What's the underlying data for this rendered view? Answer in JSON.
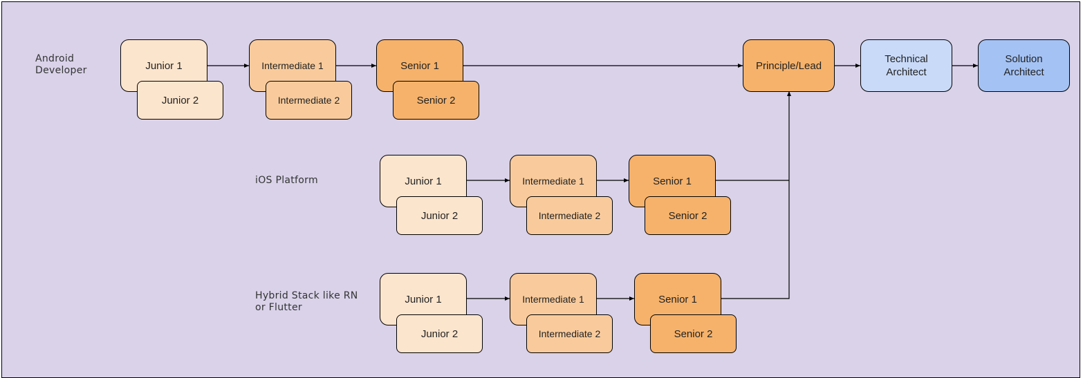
{
  "lanes": [
    {
      "label": "Android\nDeveloper",
      "junior1": "Junior 1",
      "junior2": "Junior 2",
      "inter1": "Intermediate 1",
      "inter2": "Intermediate 2",
      "senior1": "Senior 1",
      "senior2": "Senior 2"
    },
    {
      "label": "iOS Platform",
      "junior1": "Junior 1",
      "junior2": "Junior 2",
      "inter1": "Intermediate 1",
      "inter2": "Intermediate 2",
      "senior1": "Senior 1",
      "senior2": "Senior 2"
    },
    {
      "label": "Hybrid Stack like RN\nor Flutter",
      "junior1": "Junior 1",
      "junior2": "Junior 2",
      "inter1": "Intermediate 1",
      "inter2": "Intermediate 2",
      "senior1": "Senior 1",
      "senior2": "Senior 2"
    }
  ],
  "career_top": {
    "lead": "Principle/Lead",
    "tech_architect": "Technical\nArchitect",
    "solution_architect": "Solution\nArchitect"
  },
  "colors": {
    "background": "#d9d2e9",
    "junior": "#fce5cd",
    "intermediate": "#f9cb9c",
    "senior": "#f6b26b",
    "lead": "#f6b26b",
    "technical_architect": "#c9daf8",
    "solution_architect": "#a4c2f4"
  }
}
